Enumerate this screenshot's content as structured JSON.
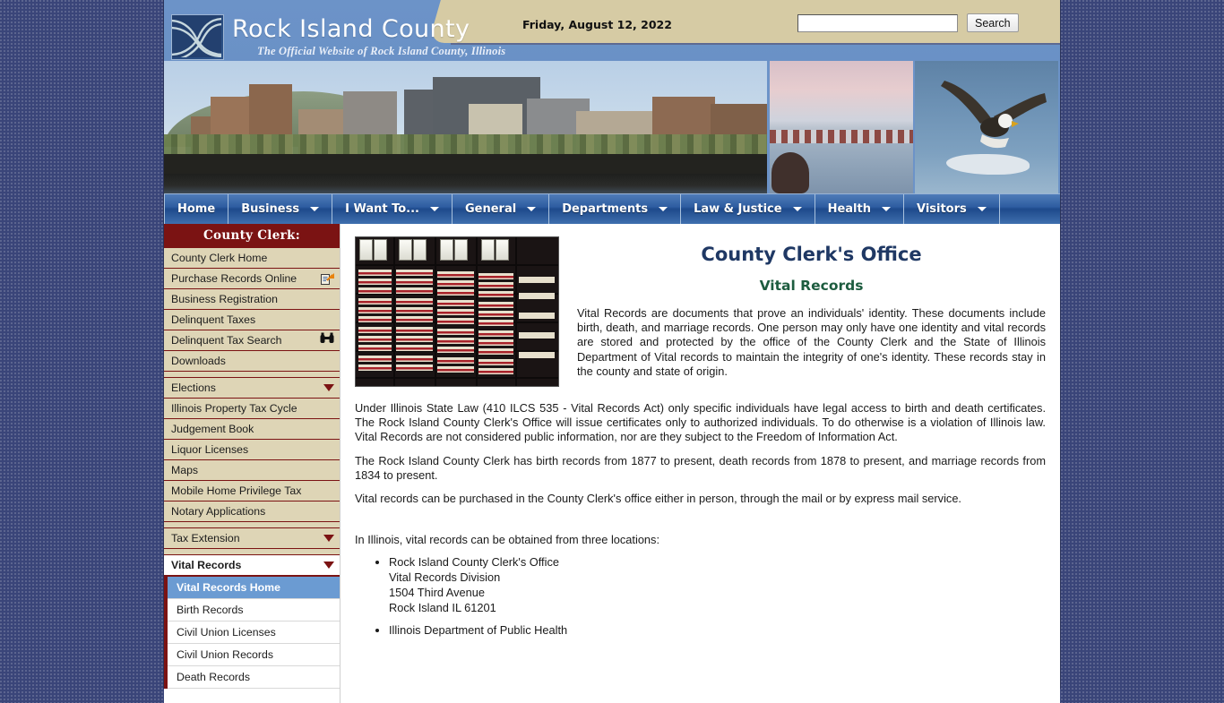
{
  "site": {
    "title": "Rock Island County",
    "subtitle": "The Official Website of Rock Island County, Illinois",
    "date": "Friday, August 12, 2022",
    "logo_icon": "county-swirl-logo"
  },
  "search": {
    "value": "",
    "placeholder": "",
    "button_label": "Search",
    "icon": "search-icon"
  },
  "nav": {
    "items": [
      {
        "label": "Home",
        "has_caret": false
      },
      {
        "label": "Business",
        "has_caret": true
      },
      {
        "label": "I Want To...",
        "has_caret": true
      },
      {
        "label": "General",
        "has_caret": true
      },
      {
        "label": "Departments",
        "has_caret": true
      },
      {
        "label": "Law & Justice",
        "has_caret": true
      },
      {
        "label": "Health",
        "has_caret": true
      },
      {
        "label": "Visitors",
        "has_caret": true
      }
    ]
  },
  "banner": {
    "images": [
      "downtown-rock-island-skyline-photo",
      "mississippi-river-dam-sunset-photo",
      "bald-eagle-on-ice-photo"
    ]
  },
  "sidebar": {
    "heading": "County Clerk:",
    "items": [
      {
        "label": "County Clerk Home",
        "icon": null,
        "caret": false,
        "gap": false
      },
      {
        "label": "Purchase Records Online",
        "icon": "external-link-icon",
        "caret": false,
        "gap": false
      },
      {
        "label": "Business Registration",
        "icon": null,
        "caret": false,
        "gap": false
      },
      {
        "label": "Delinquent Taxes",
        "icon": null,
        "caret": false,
        "gap": false
      },
      {
        "label": "Delinquent Tax Search",
        "icon": "binoculars-icon",
        "caret": false,
        "gap": false
      },
      {
        "label": "Downloads",
        "icon": null,
        "caret": false,
        "gap": false
      },
      {
        "label": "Elections",
        "icon": null,
        "caret": true,
        "gap": true
      },
      {
        "label": "Illinois Property Tax Cycle",
        "icon": null,
        "caret": false,
        "gap": false
      },
      {
        "label": "Judgement Book",
        "icon": null,
        "caret": false,
        "gap": false
      },
      {
        "label": "Liquor Licenses",
        "icon": null,
        "caret": false,
        "gap": false
      },
      {
        "label": "Maps",
        "icon": null,
        "caret": false,
        "gap": false
      },
      {
        "label": "Mobile Home Privilege Tax",
        "icon": null,
        "caret": false,
        "gap": false
      },
      {
        "label": "Notary Applications",
        "icon": null,
        "caret": false,
        "gap": false
      },
      {
        "label": "Tax Extension",
        "icon": null,
        "caret": true,
        "gap": true
      },
      {
        "label": "Vital Records",
        "icon": null,
        "caret": true,
        "gap": true,
        "open": true
      }
    ],
    "sub_items": [
      {
        "label": "Vital Records Home",
        "active": true
      },
      {
        "label": "Birth Records",
        "active": false
      },
      {
        "label": "Civil Union Licenses",
        "active": false
      },
      {
        "label": "Civil Union Records",
        "active": false
      },
      {
        "label": "Death Records",
        "active": false
      }
    ]
  },
  "main": {
    "title": "County Clerk's Office",
    "subtitle": "Vital Records",
    "image": "vital-records-archive-shelves-photo",
    "paragraphs": [
      "Vital Records are documents that prove an individuals' identity. These documents include birth, death, and marriage records. One person may only have one identity and vital records are stored and protected by the office of the County Clerk and the State of Illinois Department of Vital records to maintain the integrity of one's identity. These records stay in the county and state of origin.",
      "Under Illinois State Law (410 ILCS 535 - Vital Records Act) only specific individuals have legal access to birth and death certificates. The Rock Island County Clerk's Office will issue certificates only to authorized individuals. To do otherwise is a violation of Illinois law. Vital Records are not considered public information, nor are they subject to the Freedom of Information Act.",
      "The Rock Island County Clerk has birth records from 1877 to present, death records from 1878 to present, and marriage records from 1834 to present.",
      "Vital records can be purchased in the County Clerk's office either in person, through the mail or by express mail service.",
      "In Illinois, vital records can be obtained from three locations:"
    ],
    "locations": [
      "Rock Island County Clerk's Office\nVital Records Division\n1504 Third Avenue\nRock Island IL 61201",
      "Illinois Department of Public Health"
    ]
  },
  "colors": {
    "page_background": "#3a4579",
    "header_blue": "#6c93c8",
    "header_tan": "#d6cba4",
    "nav_blue": "#2e5da1",
    "sidebar_heading_red": "#7b1313",
    "sidebar_tan": "#ded5b6",
    "active_blue": "#6b9bd2",
    "title_navy": "#1f3864",
    "subtitle_green": "#1d5c3f"
  }
}
